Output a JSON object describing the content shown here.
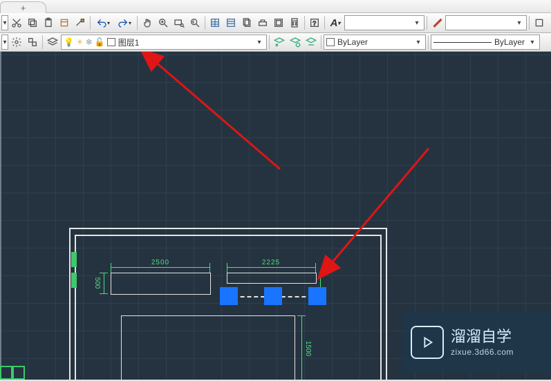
{
  "titlebar": {
    "tab_label": "+"
  },
  "toolbar1": {
    "dropdown1_value": "",
    "brush_dropdown_value": ""
  },
  "toolbar2": {
    "layer_name": "图层1",
    "color_dropdown": "ByLayer",
    "linetype_dropdown": "ByLayer"
  },
  "drawing": {
    "dim_2500": "2500",
    "dim_2225": "2225",
    "dim_500": "500",
    "dim_1500": "1500"
  },
  "watermark": {
    "title": "溜溜自学",
    "url": "zixue.3d66.com"
  }
}
